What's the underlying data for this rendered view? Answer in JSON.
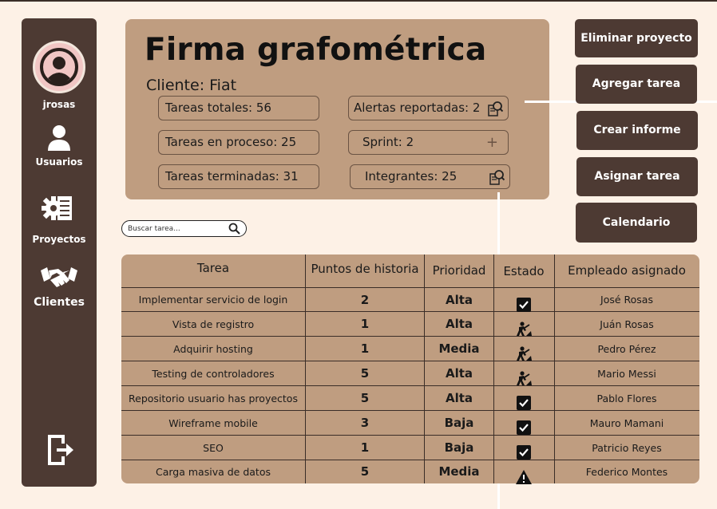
{
  "sidebar": {
    "username": "jrosas",
    "users_label": "Usuarios",
    "projects_label": "Proyectos",
    "clients_label": "Clientes",
    "icons": [
      "user-avatar-icon",
      "user-icon",
      "gear-document-icon",
      "handshake-icon",
      "logout-icon"
    ]
  },
  "project": {
    "title": "Firma grafométrica",
    "client": "Cliente: Fiat",
    "total_tasks": "Tareas totales: 56",
    "in_progress": "Tareas en proceso: 25",
    "finished": "Tareas terminadas: 31",
    "alerts": "Alertas reportadas: 2",
    "sprint": "Sprint: 2",
    "members": "Integrantes: 25"
  },
  "actions": {
    "delete_project": "Eliminar proyecto",
    "add_task": "Agregar tarea",
    "create_report": "Crear informe",
    "assign_task": "Asignar tarea",
    "calendar": "Calendario"
  },
  "search": {
    "placeholder": "Buscar tarea..."
  },
  "table": {
    "headers": {
      "task": "Tarea",
      "points": "Puntos de historia",
      "priority": "Prioridad",
      "state": "Estado",
      "assignee": "Empleado asignado"
    },
    "rows": [
      {
        "task": "Implementar servicio de login",
        "points": "2",
        "priority": "Alta",
        "state": "done",
        "assignee": "José Rosas"
      },
      {
        "task": "Vista de registro",
        "points": "1",
        "priority": "Alta",
        "state": "in-progress",
        "assignee": "Juán Rosas"
      },
      {
        "task": "Adquirir hosting",
        "points": "1",
        "priority": "Media",
        "state": "in-progress",
        "assignee": "Pedro Pérez"
      },
      {
        "task": "Testing de controladores",
        "points": "5",
        "priority": "Alta",
        "state": "in-progress",
        "assignee": "Mario Messi"
      },
      {
        "task": "Repositorio usuario has proyectos",
        "points": "5",
        "priority": "Alta",
        "state": "done",
        "assignee": "Pablo Flores"
      },
      {
        "task": "Wireframe mobile",
        "points": "3",
        "priority": "Baja",
        "state": "done",
        "assignee": "Mauro Mamani"
      },
      {
        "task": "SEO",
        "points": "1",
        "priority": "Baja",
        "state": "done",
        "assignee": "Patricio Reyes"
      },
      {
        "task": "Carga masiva de datos",
        "points": "5",
        "priority": "Media",
        "state": "warning",
        "assignee": "Federico Montes"
      }
    ]
  },
  "colors": {
    "background": "#fdf1e6",
    "sidebar": "#4d3a33",
    "card": "#bf9d80",
    "button": "#4d3a33",
    "avatar": "#f1c6c4"
  }
}
